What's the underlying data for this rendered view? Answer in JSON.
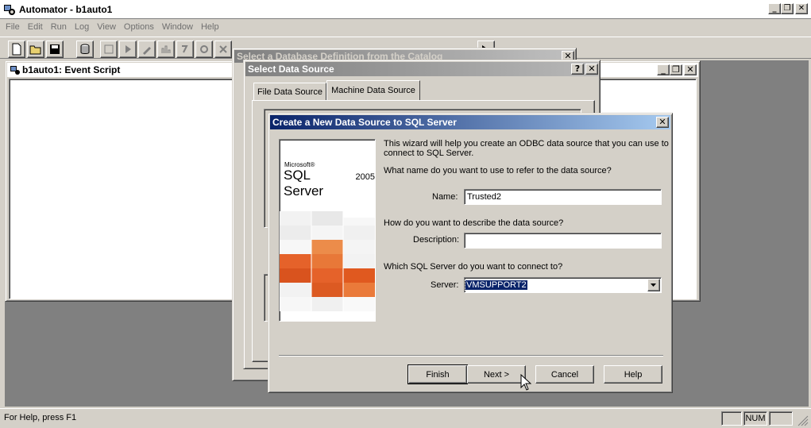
{
  "app": {
    "title": "Automator - b1auto1",
    "window_buttons": {
      "minimize": "_",
      "restore": "❐",
      "close": "✕"
    }
  },
  "menubar": {
    "items": [
      "File",
      "Edit",
      "Run",
      "Log",
      "View",
      "Options",
      "Window",
      "Help"
    ]
  },
  "toolbar": {
    "buttons": [
      "new-document-icon",
      "open-folder-icon",
      "save-icon",
      "database-icon",
      "script-icon",
      "run-icon",
      "edit-icon",
      "chart-icon",
      "step-icon",
      "settings-icon",
      "close-icon",
      "grid-icon",
      "grid-icon",
      "grid-icon",
      "help-icon"
    ]
  },
  "child_window": {
    "title": "b1auto1: Event Script"
  },
  "catalog_dialog": {
    "title": "Select a Database Definition from the Catalog"
  },
  "select_ds_dialog": {
    "title": "Select Data Source",
    "help_button": "?",
    "tabs": [
      "File Data Source",
      "Machine Data Source"
    ]
  },
  "create_ds_dialog": {
    "title": "Create a New Data Source to SQL Server",
    "logo": {
      "brand": "Microsoft®",
      "product": "SQL Server",
      "version": "2005"
    },
    "intro": "This wizard will help you create an ODBC data source that you can use to connect to SQL Server.",
    "q_name": "What name do you want to use to refer to the data source?",
    "name_label": "Name:",
    "name_value": "Trusted2",
    "q_desc": "How do you want to describe the data source?",
    "desc_label": "Description:",
    "desc_value": "",
    "q_server": "Which SQL Server do you want to connect to?",
    "server_label": "Server:",
    "server_value": "VMSUPPORT2",
    "buttons": {
      "finish": "Finish",
      "next": "Next >",
      "cancel": "Cancel",
      "help": "Help"
    }
  },
  "statusbar": {
    "help_text": "For Help, press F1",
    "num": "NUM"
  }
}
